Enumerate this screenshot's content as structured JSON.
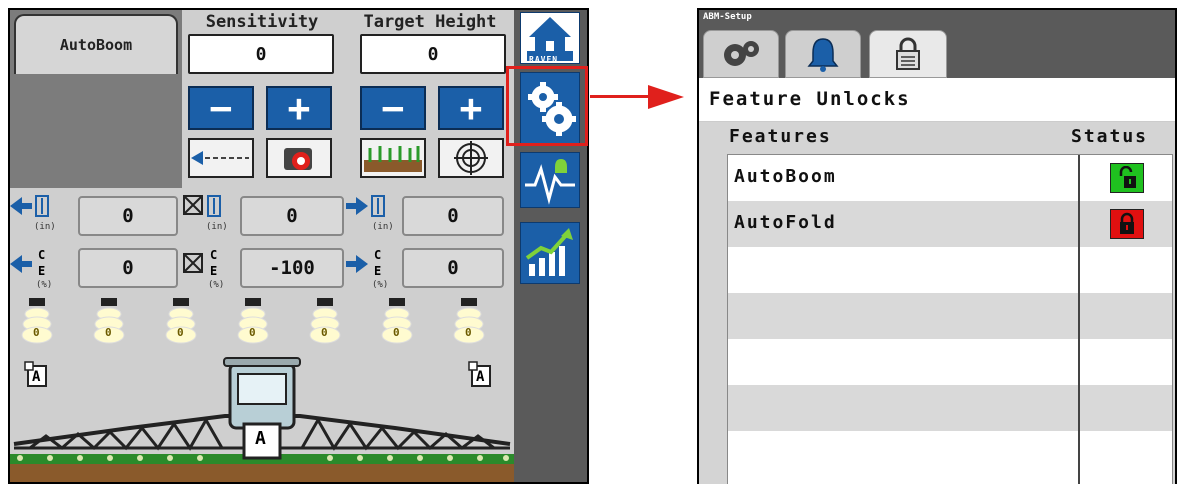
{
  "left_panel": {
    "tab_label": "AutoBoom",
    "sensitivity": {
      "label": "Sensitivity",
      "value": "0"
    },
    "target_height": {
      "label": "Target Height",
      "value": "0"
    },
    "minus_label": "−",
    "plus_label": "+",
    "height_row": {
      "left": {
        "value": "0",
        "unit": "(in)"
      },
      "center": {
        "value": "0",
        "unit": "(in)"
      },
      "right": {
        "value": "0",
        "unit": "(in)"
      }
    },
    "ce_row": {
      "left": {
        "value": "0",
        "unit": "(%)"
      },
      "center": {
        "value": "-100",
        "unit": "(%)"
      },
      "right": {
        "value": "0",
        "unit": "(%)"
      }
    },
    "nozzle_values": [
      "0",
      "0",
      "0",
      "0",
      "0",
      "0",
      "0"
    ],
    "auto_marker": "A",
    "ce_text": {
      "c": "C",
      "e": "E"
    },
    "raven_label": "RAVEN"
  },
  "right_panel": {
    "window_title": "ABM-Setup",
    "section_title": "Feature Unlocks",
    "columns": {
      "features": "Features",
      "status": "Status"
    },
    "rows": [
      {
        "feature": "AutoBoom",
        "status": "unlocked",
        "color": "#1fc11f"
      },
      {
        "feature": "AutoFold",
        "status": "locked",
        "color": "#e01010"
      },
      {
        "feature": "",
        "status": ""
      },
      {
        "feature": "",
        "status": ""
      },
      {
        "feature": "",
        "status": ""
      },
      {
        "feature": "",
        "status": ""
      },
      {
        "feature": "",
        "status": ""
      }
    ]
  },
  "colors": {
    "accent_blue": "#1b5fa8",
    "highlight_red": "#e0201c"
  },
  "icons": [
    "home-icon",
    "settings-gears-icon",
    "diagnostics-icon",
    "performance-chart-icon",
    "camera-icon",
    "target-icon",
    "crop-icon",
    "boom-icon",
    "alarm-bell-icon",
    "lock-icon"
  ]
}
